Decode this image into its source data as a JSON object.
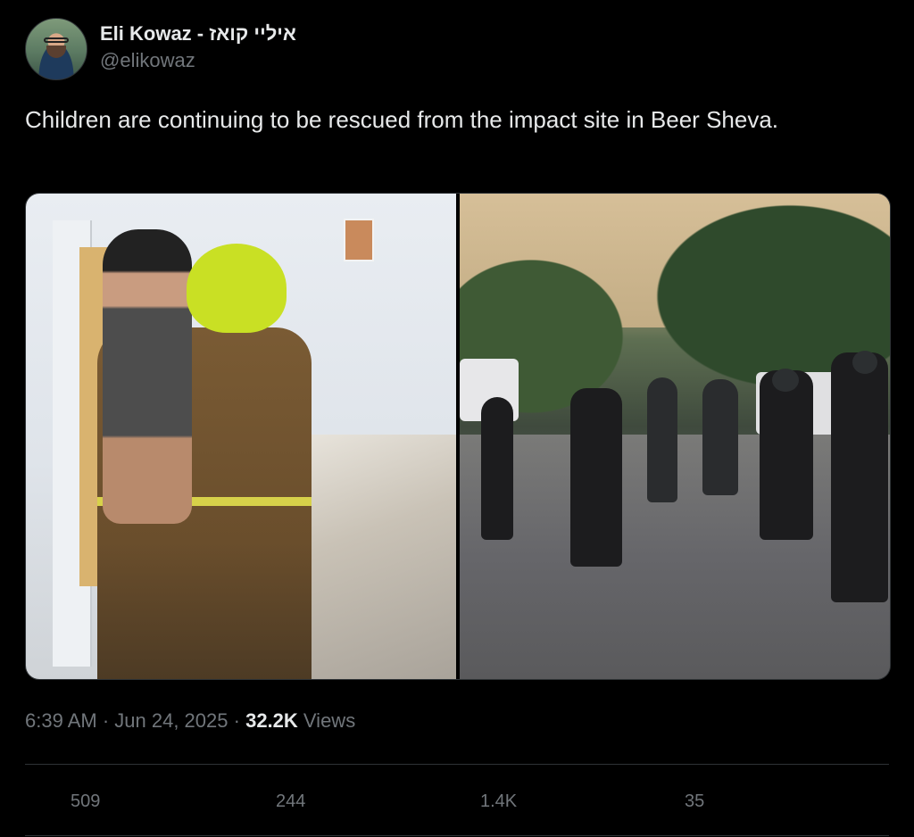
{
  "author": {
    "display_name": "Eli Kowaz - איליי קואז",
    "handle": "@elikowaz",
    "avatar_icon": "avatar-photo"
  },
  "tweet": {
    "text": "Children are continuing to be rescued from the impact site in Beer Sheva."
  },
  "media": {
    "count": 2
  },
  "meta": {
    "time": "6:39 AM",
    "sep1": " · ",
    "date": "Jun 24, 2025",
    "sep2": " · ",
    "views_count": "32.2K",
    "views_label": " Views"
  },
  "actions": {
    "replies": "509",
    "reposts": "244",
    "likes": "1.4K",
    "bookmarks": "35"
  },
  "colors": {
    "background": "#000000",
    "text_primary": "#e7e9ea",
    "text_secondary": "#71767b",
    "divider": "#2f3336"
  }
}
